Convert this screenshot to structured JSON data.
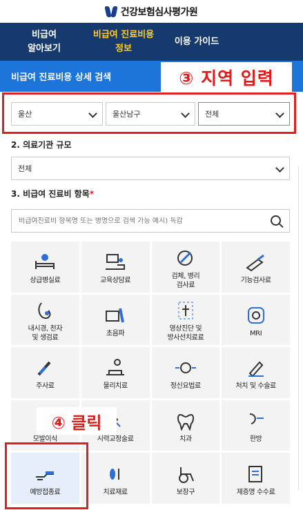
{
  "header": {
    "logo_text": "건강보험심사평가원"
  },
  "nav": {
    "items": [
      {
        "label": "비급여\n알아보기",
        "active": false
      },
      {
        "label": "비급여 진료비용\n정보",
        "active": true
      },
      {
        "label": "이용 가이드",
        "active": false
      }
    ]
  },
  "section": {
    "title": "비급여 진료비용 상세 검색"
  },
  "annotations": {
    "step3": "③ 지역 입력",
    "step4": "④ 클릭"
  },
  "region": {
    "sido": "울산",
    "sigungu": "울산남구",
    "dong": "전체"
  },
  "scale": {
    "label": "2. 의료기관 규모",
    "value": "전체"
  },
  "items": {
    "label": "3. 비급여 진료비 항목",
    "required_mark": "*",
    "placeholder": "비급여진료비 항목명 또는 병명으로 검색 가능 예시) 독감"
  },
  "categories": [
    {
      "label": "상급병실료",
      "icon": "hospital-bed-icon"
    },
    {
      "label": "교육상담료",
      "icon": "counseling-icon"
    },
    {
      "label": "검체, 병리\n검사료",
      "icon": "pathology-icon"
    },
    {
      "label": "기능검사료",
      "icon": "function-test-icon"
    },
    {
      "label": "내시경, 천자\n및 생검료",
      "icon": "endoscope-icon"
    },
    {
      "label": "초음파",
      "icon": "ultrasound-icon"
    },
    {
      "label": "영상진단 및\n방사선치료료",
      "icon": "xray-icon"
    },
    {
      "label": "MRI",
      "icon": "mri-icon"
    },
    {
      "label": "주사료",
      "icon": "syringe-icon"
    },
    {
      "label": "물리치료",
      "icon": "physical-therapy-icon"
    },
    {
      "label": "정신요법료",
      "icon": "psychotherapy-icon"
    },
    {
      "label": "처치 및 수술료",
      "icon": "surgery-icon"
    },
    {
      "label": "모발이식",
      "icon": "hair-icon"
    },
    {
      "label": "시력교정술료",
      "icon": "vision-icon"
    },
    {
      "label": "치과",
      "icon": "tooth-icon"
    },
    {
      "label": "한방",
      "icon": "oriental-medicine-icon"
    },
    {
      "label": "예방접종료",
      "icon": "vaccine-icon"
    },
    {
      "label": "치료재료",
      "icon": "medical-material-icon"
    },
    {
      "label": "보장구",
      "icon": "wheelchair-icon"
    },
    {
      "label": "제증명 수수료",
      "icon": "certificate-icon"
    }
  ],
  "colors": {
    "nav_bg": "#173a6e",
    "accent": "#1d74d9",
    "active_nav": "#ffcc33",
    "annotation": "#e02020"
  }
}
